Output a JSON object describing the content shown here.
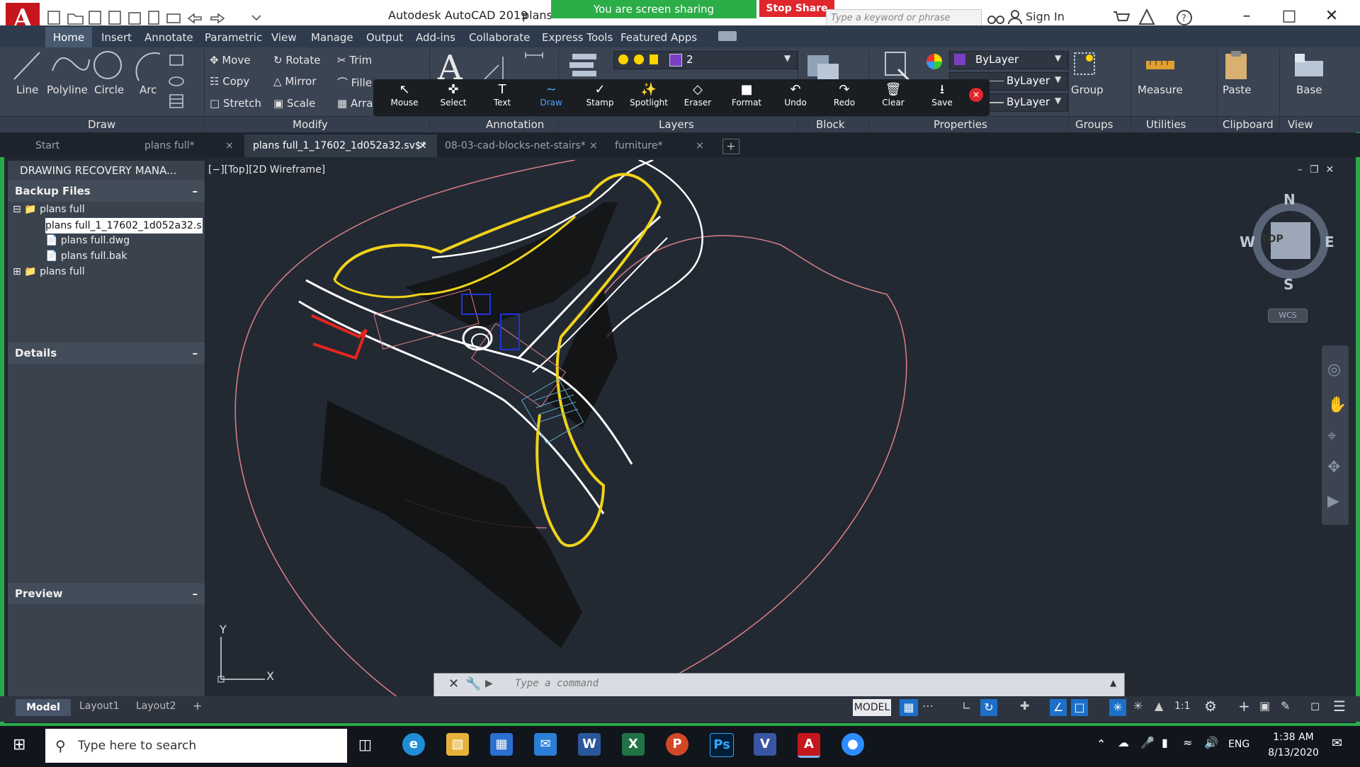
{
  "titlebar": {
    "app_title": "Autodesk AutoCAD 2019",
    "doc_title": "plans",
    "share_text": "You are screen sharing",
    "stop_share": "Stop Share",
    "search_placeholder": "Type a keyword or phrase",
    "sign_in": "Sign In"
  },
  "ribbon_tabs": [
    "Home",
    "Insert",
    "Annotate",
    "Parametric",
    "View",
    "Manage",
    "Output",
    "Add-ins",
    "Collaborate",
    "Express Tools",
    "Featured Apps"
  ],
  "draw_tools": {
    "line": "Line",
    "polyline": "Polyline",
    "circle": "Circle",
    "arc": "Arc"
  },
  "modify_tools": {
    "move": "Move",
    "rotate": "Rotate",
    "trim": "Trim",
    "copy": "Copy",
    "mirror": "Mirror",
    "fillet": "Fille",
    "stretch": "Stretch",
    "scale": "Scale",
    "array": "Arra"
  },
  "annotation_toolbar": [
    "Mouse",
    "Select",
    "Text",
    "Draw",
    "Stamp",
    "Spotlight",
    "Eraser",
    "Format",
    "Undo",
    "Redo",
    "Clear",
    "Save"
  ],
  "layer": {
    "name": "2",
    "bylayer_color": "ByLayer",
    "bylayer_linetype": "ByLayer",
    "bylayer_lineweight": "ByLayer"
  },
  "right_tools": {
    "group": "Group",
    "measure": "Measure",
    "paste": "Paste",
    "base": "Base"
  },
  "panel_titles": {
    "draw": "Draw",
    "modify": "Modify",
    "annotation": "Annotation",
    "layers": "Layers",
    "block": "Block",
    "properties": "Properties",
    "groups": "Groups",
    "utilities": "Utilities",
    "clipboard": "Clipboard",
    "view": "View"
  },
  "file_tabs": [
    "Start",
    "plans full*",
    "plans full_1_17602_1d052a32.sv$*",
    "08-03-cad-blocks-net-stairs*",
    "furniture*"
  ],
  "palette": {
    "title": "DRAWING RECOVERY MANA...",
    "backup_header": "Backup Files",
    "tree": [
      {
        "label": "plans full"
      },
      {
        "label": "plans full_1_17602_1d052a32.s"
      },
      {
        "label": "plans full.dwg"
      },
      {
        "label": "plans full.bak"
      },
      {
        "label": "plans full"
      }
    ],
    "details": "Details",
    "preview": "Preview"
  },
  "viewport": {
    "label": "[−][Top][2D Wireframe]",
    "viewcube": {
      "n": "N",
      "s": "S",
      "e": "E",
      "w": "W",
      "top": "TOP",
      "wcs": "WCS"
    },
    "ucs": {
      "x": "X",
      "y": "Y"
    }
  },
  "command": {
    "placeholder": "Type a command"
  },
  "layout_tabs": [
    "Model",
    "Layout1",
    "Layout2"
  ],
  "status": {
    "model": "MODEL",
    "scale": "1:1"
  },
  "taskbar": {
    "search": "Type here to search",
    "lang": "ENG",
    "time": "1:38 AM",
    "date": "8/13/2020"
  },
  "colors": {
    "accent": "#29a94a",
    "stop": "#e0272c",
    "drawing_yellow": "#f0d21a",
    "drawing_red": "#e8251d",
    "drawing_pink": "#e07f86"
  }
}
